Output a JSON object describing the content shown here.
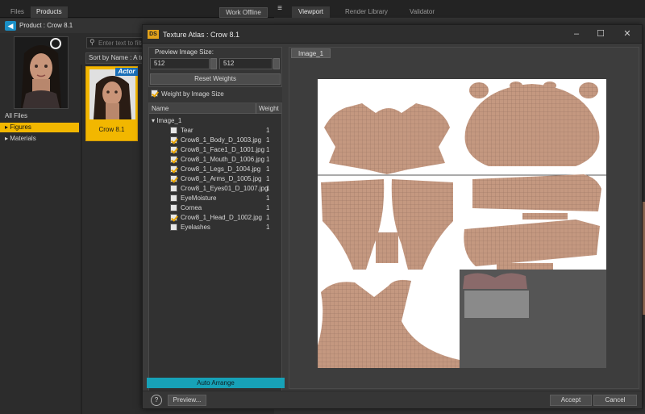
{
  "left_panel": {
    "tabs": [
      "Files",
      "Products"
    ],
    "work_offline": "Work Offline",
    "product_label": "Product : Crow 8.1",
    "search_placeholder": "Enter text to filter",
    "sort_label": "Sort by Name : A to Z",
    "nav_items": [
      "All Files",
      "Figures",
      "Materials"
    ],
    "selected_nav": "Figures",
    "card": {
      "badge": "Actor",
      "name": "Crow 8.1"
    }
  },
  "viewport": {
    "tabs": [
      "Viewport",
      "Render Library",
      "Validator"
    ]
  },
  "dialog": {
    "app_icon": "DS",
    "title": "Texture Atlas : Crow 8.1",
    "preview_size_label": "Preview Image Size:",
    "width": "512",
    "height": "512",
    "reset_weights": "Reset Weights",
    "weight_by_size": "Weight by Image Size",
    "col_name": "Name",
    "col_weight": "Weight",
    "group": "Image_1",
    "items": [
      {
        "name": "Tear",
        "checked": false,
        "weight": "1"
      },
      {
        "name": "Crow8_1_Body_D_1003.jpg",
        "checked": true,
        "weight": "1"
      },
      {
        "name": "Crow8_1_Face1_D_1001.jpg",
        "checked": true,
        "weight": "1"
      },
      {
        "name": "Crow8_1_Mouth_D_1006.jpg",
        "checked": true,
        "weight": "1"
      },
      {
        "name": "Crow8_1_Legs_D_1004.jpg",
        "checked": true,
        "weight": "1"
      },
      {
        "name": "Crow8_1_Arms_D_1005.jpg",
        "checked": true,
        "weight": "1"
      },
      {
        "name": "Crow8_1_Eyes01_D_1007.jpg",
        "checked": false,
        "weight": "1"
      },
      {
        "name": "EyeMoisture",
        "checked": false,
        "weight": "1"
      },
      {
        "name": "Cornea",
        "checked": false,
        "weight": "1"
      },
      {
        "name": "Crow8_1_Head_D_1002.jpg",
        "checked": true,
        "weight": "1"
      },
      {
        "name": "Eyelashes",
        "checked": false,
        "weight": "1"
      }
    ],
    "auto_arrange": "Auto Arrange",
    "image_tab": "Image_1",
    "help": "?",
    "preview_btn": "Preview...",
    "accept": "Accept",
    "cancel": "Cancel"
  },
  "colors": {
    "accent": "#f2b700",
    "auto_arrange": "#17a2b8",
    "uv_skin": "#c49880"
  }
}
